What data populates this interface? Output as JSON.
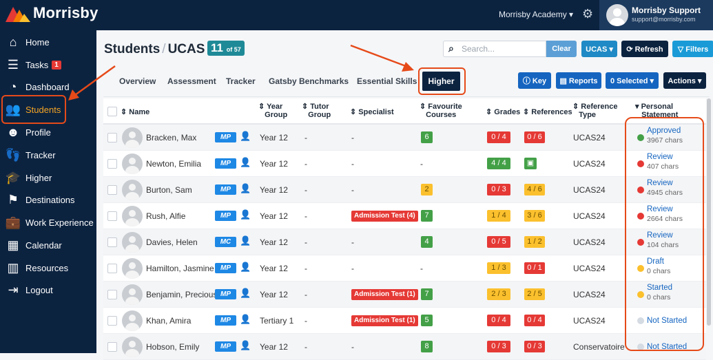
{
  "topbar": {
    "brand": "Morrisby",
    "academy": "Morrisby Academy ▾",
    "user_name": "Morrisby Support",
    "user_email": "support@morrisby.com"
  },
  "sidebar": {
    "items": [
      {
        "label": "Home",
        "icon": "home-icon"
      },
      {
        "label": "Tasks",
        "icon": "tasks-icon",
        "badge": "1"
      },
      {
        "label": "Dashboard",
        "icon": "dashboard-icon"
      },
      {
        "label": "Students",
        "icon": "students-icon",
        "active": true
      },
      {
        "label": "Profile",
        "icon": "profile-icon"
      },
      {
        "label": "Tracker",
        "icon": "tracker-icon"
      },
      {
        "label": "Higher",
        "icon": "graduation-icon"
      },
      {
        "label": "Destinations",
        "icon": "signpost-icon"
      },
      {
        "label": "Work Experience",
        "icon": "briefcase-icon"
      },
      {
        "label": "Calendar",
        "icon": "calendar-icon"
      },
      {
        "label": "Resources",
        "icon": "books-icon"
      },
      {
        "label": "Logout",
        "icon": "logout-icon"
      }
    ]
  },
  "page": {
    "title": "Students",
    "subtitle": "UCAS",
    "count": "11",
    "count_of": "of 57"
  },
  "search": {
    "placeholder": "Search..."
  },
  "toolbar": {
    "clear": "Clear",
    "ucas": "UCAS ▾",
    "refresh": "⟳ Refresh",
    "filters": "▽ Filters"
  },
  "tabs": {
    "items": [
      "Overview",
      "Assessment",
      "Tracker",
      "Gatsby Benchmarks",
      "Essential Skills"
    ],
    "active": "Higher"
  },
  "actions": {
    "key": "ⓘ Key",
    "reports": "▤ Reports",
    "selected": "0 Selected ▾",
    "actions": "Actions ▾"
  },
  "columns": {
    "name": "Name",
    "year_group_1": "Year",
    "year_group_2": "Group",
    "tutor_group_1": "Tutor",
    "tutor_group_2": "Group",
    "specialist": "Specialist",
    "fav_1": "Favourite",
    "fav_2": "Courses",
    "grades": "Grades",
    "references": "References",
    "ref_type_1": "Reference",
    "ref_type_2": "Type",
    "ps_1": "Personal",
    "ps_2": "Statement"
  },
  "rows": [
    {
      "name": "Bracken, Max",
      "tag": "MP",
      "year": "Year 12",
      "tutor": "-",
      "specialist": "-",
      "fav": "6",
      "grades": "0 / 4",
      "refs": "0 / 6",
      "ref_type": "UCAS24",
      "status": "Approved",
      "chars": "3967 chars"
    },
    {
      "name": "Newton, Emilia",
      "tag": "MP",
      "year": "Year 12",
      "tutor": "-",
      "specialist": "-",
      "fav": "-",
      "grades": "4 / 4",
      "refs": "▣",
      "ref_type": "UCAS24",
      "status": "Review",
      "chars": "407 chars"
    },
    {
      "name": "Burton, Sam",
      "tag": "MP",
      "year": "Year 12",
      "tutor": "-",
      "specialist": "-",
      "fav": "2",
      "grades": "0 / 3",
      "refs": "4 / 6",
      "ref_type": "UCAS24",
      "status": "Review",
      "chars": "4945 chars"
    },
    {
      "name": "Rush, Alfie",
      "tag": "MP",
      "year": "Year 12",
      "tutor": "-",
      "specialist": "Admission Test (4)",
      "fav": "7",
      "grades": "1 / 4",
      "refs": "3 / 6",
      "ref_type": "UCAS24",
      "status": "Review",
      "chars": "2664 chars"
    },
    {
      "name": "Davies, Helen",
      "tag": "MC",
      "year": "Year 12",
      "tutor": "-",
      "specialist": "-",
      "fav": "4",
      "grades": "0 / 5",
      "refs": "1 / 2",
      "ref_type": "UCAS24",
      "status": "Review",
      "chars": "104 chars"
    },
    {
      "name": "Hamilton, Jasmine",
      "tag": "MP",
      "year": "Year 12",
      "tutor": "-",
      "specialist": "-",
      "fav": "-",
      "grades": "1 / 3",
      "refs": "0 / 1",
      "ref_type": "UCAS24",
      "status": "Draft",
      "chars": "0 chars"
    },
    {
      "name": "Benjamin, Precious",
      "tag": "MP",
      "year": "Year 12",
      "tutor": "-",
      "specialist": "Admission Test (1)",
      "fav": "7",
      "grades": "2 / 3",
      "refs": "2 / 5",
      "ref_type": "UCAS24",
      "status": "Started",
      "chars": "0 chars"
    },
    {
      "name": "Khan, Amira",
      "tag": "MP",
      "year": "Tertiary 1",
      "tutor": "-",
      "specialist": "Admission Test (1)",
      "fav": "5",
      "grades": "0 / 4",
      "refs": "0 / 4",
      "ref_type": "UCAS24",
      "status": "Not Started",
      "chars": ""
    },
    {
      "name": "Hobson, Emily",
      "tag": "MP",
      "year": "Year 12",
      "tutor": "-",
      "specialist": "-",
      "fav": "8",
      "grades": "0 / 3",
      "refs": "0 / 3",
      "ref_type": "Conservatoire",
      "status": "Not Started",
      "chars": ""
    }
  ],
  "colors": {
    "navy": "#0c2340",
    "teal": "#1f8a97",
    "green": "#43a047",
    "red": "#e53935",
    "yellow": "#fbc02d",
    "grey": "#d5dbe3",
    "annotation": "#e64a19"
  }
}
